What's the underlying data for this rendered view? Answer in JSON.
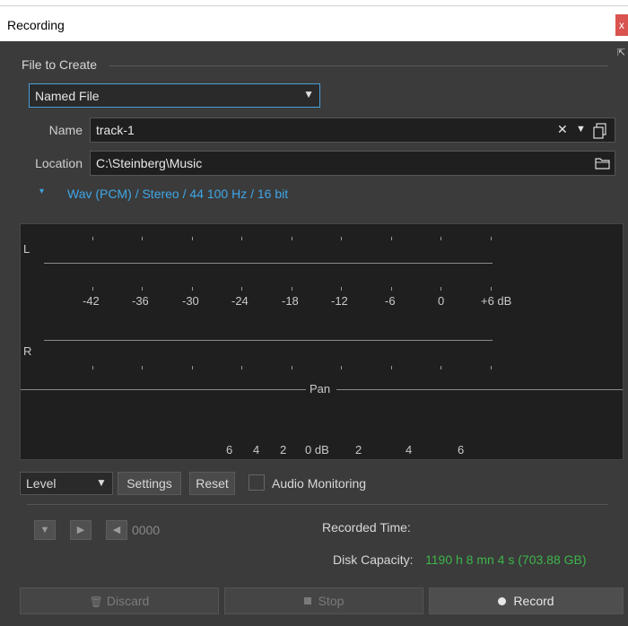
{
  "window": {
    "title": "Recording",
    "close_glyph": "x",
    "pin_glyph": "⇱"
  },
  "file_group": {
    "label": "File to Create",
    "mode_value": "Named File",
    "name_label": "Name",
    "name_value": "track-1",
    "location_label": "Location",
    "location_value": "C:\\Steinberg\\Music",
    "format_text": "Wav (PCM) / Stereo / 44 100 Hz / 16 bit"
  },
  "meter": {
    "left_channel": "L",
    "right_channel": "R",
    "db_scale": [
      "-42",
      "-36",
      "-30",
      "-24",
      "-18",
      "-12",
      "-6",
      "0",
      "+6 dB"
    ],
    "pan_label": "Pan",
    "pan_scale": [
      "6",
      "4",
      "2",
      "0 dB",
      "2",
      "4",
      "6"
    ]
  },
  "controls": {
    "level_value": "Level",
    "settings_label": "Settings",
    "reset_label": "Reset",
    "monitoring_label": "Audio Monitoring",
    "monitoring_checked": false
  },
  "transport": {
    "counter": "0000",
    "recorded_time_label": "Recorded Time:",
    "recorded_time_value": "",
    "disk_capacity_label": "Disk Capacity:",
    "disk_capacity_value": "1190 h 8 mn 4 s (703.88 GB)"
  },
  "actions": {
    "discard_label": "Discard",
    "stop_label": "Stop",
    "record_label": "Record"
  },
  "colors": {
    "accent_blue": "#3fa6e6",
    "disk_green": "#3db54a",
    "close_red": "#d9534f"
  }
}
